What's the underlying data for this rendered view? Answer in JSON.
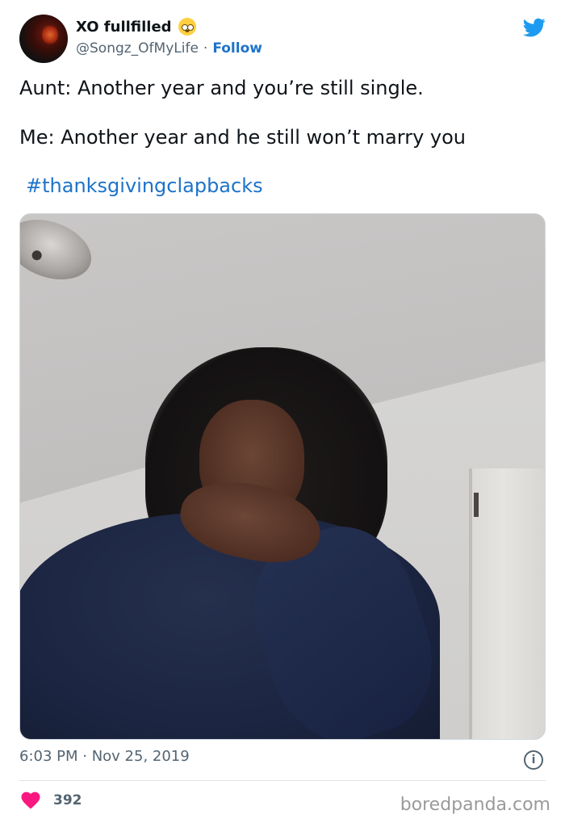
{
  "tweet": {
    "display_name": "XO fullfilled",
    "handle": "@Songz_OfMyLife",
    "separator": "·",
    "follow_label": "Follow",
    "text_line1": "Aunt: Another year and you’re still single.",
    "text_line2": "Me: Another year and he still won’t marry you",
    "hashtag": "#thanksgivingclapbacks",
    "timestamp": "6:03 PM · Nov 25, 2019",
    "likes": "392",
    "info_glyph": "i"
  },
  "watermark": "boredpanda.com",
  "icons": {
    "brand": "twitter-bird-icon",
    "like": "heart-icon",
    "info": "info-icon",
    "emoji": "pleading-face-emoji-icon"
  },
  "colors": {
    "link": "#1d73c9",
    "twitter_blue": "#1d9bf0",
    "heart": "#f91880",
    "muted": "#536471"
  }
}
